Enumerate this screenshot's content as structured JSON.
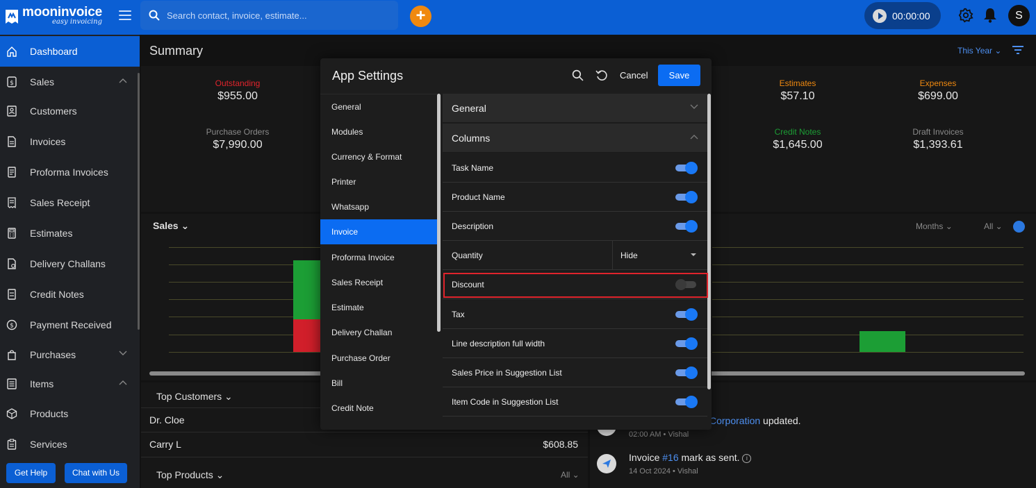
{
  "brand": {
    "name": "mooninvoice",
    "tagline": "easy invoicing"
  },
  "header": {
    "search_placeholder": "Search contact, invoice, estimate...",
    "add_label": "+",
    "timer": "00:00:00",
    "avatar_initial": "S"
  },
  "sidebar": {
    "items": [
      {
        "label": "Dashboard",
        "icon": "home-icon",
        "active": true
      },
      {
        "label": "Sales",
        "icon": "dollar-doc-icon",
        "expanded": true
      },
      {
        "label": "Customers",
        "icon": "contacts-icon"
      },
      {
        "label": "Invoices",
        "icon": "invoice-icon"
      },
      {
        "label": "Proforma Invoices",
        "icon": "proforma-icon"
      },
      {
        "label": "Sales Receipt",
        "icon": "receipt-icon"
      },
      {
        "label": "Estimates",
        "icon": "calculator-icon"
      },
      {
        "label": "Delivery Challans",
        "icon": "delivery-doc-icon"
      },
      {
        "label": "Credit Notes",
        "icon": "credit-note-icon"
      },
      {
        "label": "Payment Received",
        "icon": "payment-icon"
      },
      {
        "label": "Purchases",
        "icon": "purchase-bag-icon",
        "expanded": false
      },
      {
        "label": "Items",
        "icon": "list-icon",
        "expanded": true
      },
      {
        "label": "Products",
        "icon": "box-icon"
      },
      {
        "label": "Services",
        "icon": "clipboard-icon"
      }
    ],
    "get_help": "Get Help",
    "chat": "Chat with Us"
  },
  "dashboard": {
    "summary_title": "Summary",
    "period": "This Year",
    "cards": [
      {
        "label": "Outstanding",
        "value": "$955.00",
        "color": "#e0242c"
      },
      {
        "label": "Estimates",
        "value": "$57.10",
        "color": "#f0890f"
      },
      {
        "label": "Expenses",
        "value": "$699.00",
        "color": "#f0890f"
      },
      {
        "label": "Purchase Orders",
        "value": "$7,990.00",
        "color": "#8a8a8a"
      },
      {
        "label": "Credit Notes",
        "value": "$1,645.00",
        "color": "#1c9e35"
      },
      {
        "label": "Draft Invoices",
        "value": "$1,393.61",
        "color": "#8a8a8a"
      }
    ],
    "sales_title": "Sales",
    "months_label": "Months",
    "all_label": "All",
    "top_customers_title": "Top Customers",
    "customers": [
      {
        "name": "Dr. Cloe",
        "value": ""
      },
      {
        "name": "Carry L",
        "value": "$608.85"
      }
    ],
    "top_products_title": "Top Products",
    "top_products_filter": "All",
    "activity": [
      {
        "prefix": "",
        "link": "Corporation",
        "suffix": " updated.",
        "meta": "02:00 AM • Vishal"
      },
      {
        "prefix": "Invoice ",
        "link": "#16",
        "suffix": " mark as sent.",
        "meta": "14 Oct 2024 • Vishal"
      }
    ]
  },
  "modal": {
    "title": "App Settings",
    "cancel": "Cancel",
    "save": "Save",
    "nav": [
      {
        "label": "General"
      },
      {
        "label": "Modules"
      },
      {
        "label": "Currency & Format"
      },
      {
        "label": "Printer"
      },
      {
        "label": "Whatsapp"
      },
      {
        "label": "Invoice",
        "active": true
      },
      {
        "label": "Proforma Invoice"
      },
      {
        "label": "Sales Receipt"
      },
      {
        "label": "Estimate"
      },
      {
        "label": "Delivery Challan"
      },
      {
        "label": "Purchase Order"
      },
      {
        "label": "Bill"
      },
      {
        "label": "Credit Note"
      }
    ],
    "sections": {
      "general": "General",
      "columns": "Columns"
    },
    "columns": [
      {
        "label": "Task Name",
        "type": "toggle",
        "on": true
      },
      {
        "label": "Product Name",
        "type": "toggle",
        "on": true
      },
      {
        "label": "Description",
        "type": "toggle",
        "on": true
      },
      {
        "label": "Quantity",
        "type": "select",
        "value": "Hide"
      },
      {
        "label": "Discount",
        "type": "toggle",
        "on": false
      },
      {
        "label": "Tax",
        "type": "toggle",
        "on": true
      },
      {
        "label": "Line description full width",
        "type": "toggle",
        "on": true
      },
      {
        "label": "Sales Price in Suggestion List",
        "type": "toggle",
        "on": true
      },
      {
        "label": "Item Code in Suggestion List",
        "type": "toggle",
        "on": true
      }
    ]
  }
}
